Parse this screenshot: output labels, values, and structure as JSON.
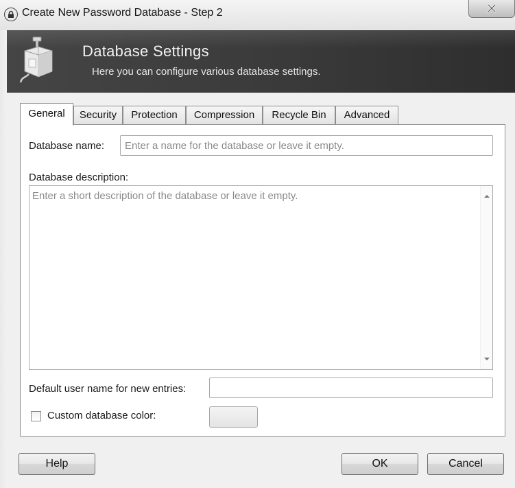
{
  "window": {
    "title": "Create New Password Database - Step 2"
  },
  "banner": {
    "title": "Database Settings",
    "subtitle": "Here you can configure various database settings."
  },
  "tabs": [
    {
      "label": "General",
      "active": true
    },
    {
      "label": "Security",
      "active": false
    },
    {
      "label": "Protection",
      "active": false
    },
    {
      "label": "Compression",
      "active": false
    },
    {
      "label": "Recycle Bin",
      "active": false
    },
    {
      "label": "Advanced",
      "active": false
    }
  ],
  "general": {
    "db_name_label": "Database name:",
    "db_name_value": "",
    "db_name_placeholder": "Enter a name for the database or leave it empty.",
    "db_desc_label": "Database description:",
    "db_desc_value": "",
    "db_desc_placeholder": "Enter a short description of the database or leave it empty.",
    "default_user_label": "Default user name for new entries:",
    "default_user_value": "",
    "custom_color_label": "Custom database color:",
    "custom_color_checked": false
  },
  "buttons": {
    "help": "Help",
    "ok": "OK",
    "cancel": "Cancel"
  },
  "icons": {
    "window_icon": "lock-icon",
    "close": "close-icon",
    "banner_icon": "database-icon"
  }
}
